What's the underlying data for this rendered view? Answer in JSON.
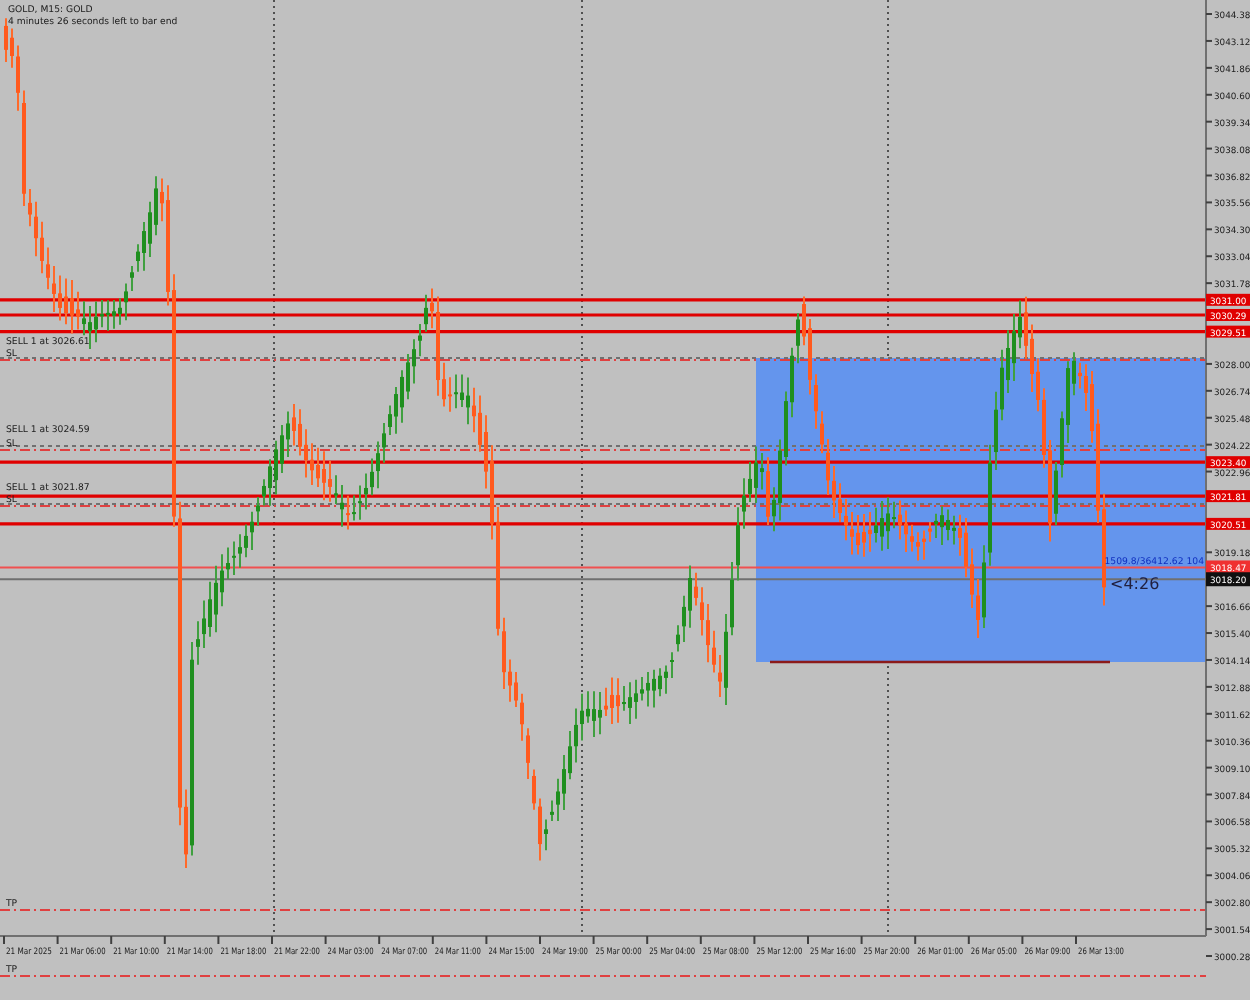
{
  "chart": {
    "symbol_label": "GOLD, M15: GOLD",
    "timer_label": "4 minutes 26 seconds left to bar end",
    "price_ticks": [
      "3044.38",
      "3043.12",
      "3041.86",
      "3040.60",
      "3039.34",
      "3038.08",
      "3036.82",
      "3035.56",
      "3034.30",
      "3033.04",
      "3031.78",
      "3028.00",
      "3026.74",
      "3025.48",
      "3024.22",
      "3022.96",
      "3019.18",
      "3016.66",
      "3015.40",
      "3014.14",
      "3012.88",
      "3011.62",
      "3010.36",
      "3009.10",
      "3007.84",
      "3006.58",
      "3005.32",
      "3004.06",
      "3002.80",
      "3001.54",
      "3000.28"
    ],
    "time_ticks": [
      "21 Mar 2025",
      "21 Mar 06:00",
      "21 Mar 10:00",
      "21 Mar 14:00",
      "21 Mar 18:00",
      "21 Mar 22:00",
      "24 Mar 03:00",
      "24 Mar 07:00",
      "24 Mar 11:00",
      "24 Mar 15:00",
      "24 Mar 19:00",
      "25 Mar 00:00",
      "25 Mar 04:00",
      "25 Mar 08:00",
      "25 Mar 12:00",
      "25 Mar 16:00",
      "25 Mar 20:00",
      "26 Mar 01:00",
      "26 Mar 05:00",
      "26 Mar 09:00",
      "26 Mar 13:00"
    ],
    "levels": [
      {
        "price_tag": "3031.00"
      },
      {
        "price_tag": "3030.29"
      },
      {
        "price_tag": "3029.51"
      },
      {
        "price_tag": "3023.40"
      },
      {
        "price_tag": "3021.81"
      },
      {
        "price_tag": "3020.51"
      }
    ],
    "orders": [
      {
        "label": "SELL 1 at 3026.61",
        "sl": "SL"
      },
      {
        "label": "SELL 1 at 3024.59",
        "sl": "SL"
      },
      {
        "label": "SELL 1 at 3021.87",
        "sl": "SL"
      }
    ],
    "tp_labels": [
      "TP",
      "TP"
    ],
    "ask_tag": "3018.47",
    "bid_tag": "3018.20",
    "box": {
      "label": "1509.8/36412.62 104",
      "countdown": "<4:26"
    }
  }
}
